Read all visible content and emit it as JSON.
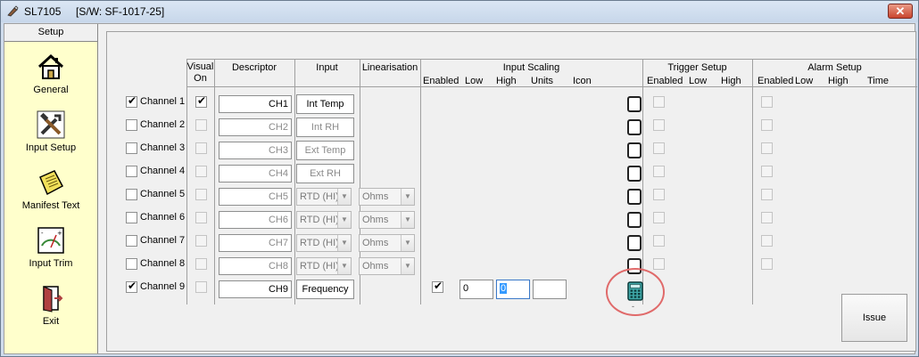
{
  "window": {
    "title": "SL7105     [S/W: SF-1017-25]",
    "close_glyph": "✕"
  },
  "sidebar": {
    "heading": "Setup",
    "items": [
      {
        "label": "General",
        "icon": "home-icon"
      },
      {
        "label": "Input Setup",
        "icon": "tools-icon"
      },
      {
        "label": "Manifest Text",
        "icon": "note-icon"
      },
      {
        "label": "Input Trim",
        "icon": "gauge-icon"
      },
      {
        "label": "Exit",
        "icon": "exit-door-icon"
      }
    ]
  },
  "headers": {
    "visual_on_1": "Visual",
    "visual_on_2": "On",
    "descriptor": "Descriptor",
    "input": "Input",
    "linearisation": "Linearisation",
    "input_scaling": "Input Scaling",
    "scaling_enabled": "Enabled",
    "scaling_low": "Low",
    "scaling_high": "High",
    "scaling_units": "Units",
    "scaling_icon": "Icon",
    "trigger_setup": "Trigger Setup",
    "trigger_enabled": "Enabled",
    "trigger_low": "Low",
    "trigger_high": "High",
    "alarm_setup": "Alarm Setup",
    "alarm_enabled": "Enabled",
    "alarm_low": "Low",
    "alarm_high": "High",
    "alarm_time": "Time"
  },
  "channels": [
    {
      "label": "Channel 1",
      "enabled": true,
      "visual_on": true,
      "descriptor": "CH1",
      "input": "Int Temp",
      "linearisation": ""
    },
    {
      "label": "Channel 2",
      "enabled": false,
      "visual_on": false,
      "descriptor": "CH2",
      "input": "Int RH",
      "linearisation": ""
    },
    {
      "label": "Channel 3",
      "enabled": false,
      "visual_on": false,
      "descriptor": "CH3",
      "input": "Ext Temp",
      "linearisation": ""
    },
    {
      "label": "Channel 4",
      "enabled": false,
      "visual_on": false,
      "descriptor": "CH4",
      "input": "Ext RH",
      "linearisation": ""
    },
    {
      "label": "Channel 5",
      "enabled": false,
      "visual_on": false,
      "descriptor": "CH5",
      "input": "RTD (HI)",
      "linearisation": "Ohms"
    },
    {
      "label": "Channel 6",
      "enabled": false,
      "visual_on": false,
      "descriptor": "CH6",
      "input": "RTD (HI)",
      "linearisation": "Ohms"
    },
    {
      "label": "Channel 7",
      "enabled": false,
      "visual_on": false,
      "descriptor": "CH7",
      "input": "RTD (HI)",
      "linearisation": "Ohms"
    },
    {
      "label": "Channel 8",
      "enabled": false,
      "visual_on": false,
      "descriptor": "CH8",
      "input": "RTD (HI)",
      "linearisation": "Ohms"
    },
    {
      "label": "Channel 9",
      "enabled": true,
      "visual_on": false,
      "descriptor": "CH9",
      "input": "Frequency",
      "linearisation": "",
      "scaling_enabled": true,
      "scaling_low": "0",
      "scaling_high": "0",
      "scaling_units": ""
    }
  ],
  "check_glyph": "✔",
  "combo_arrow": "▼",
  "issue_button": "Issue",
  "below_icon_mark": "-"
}
